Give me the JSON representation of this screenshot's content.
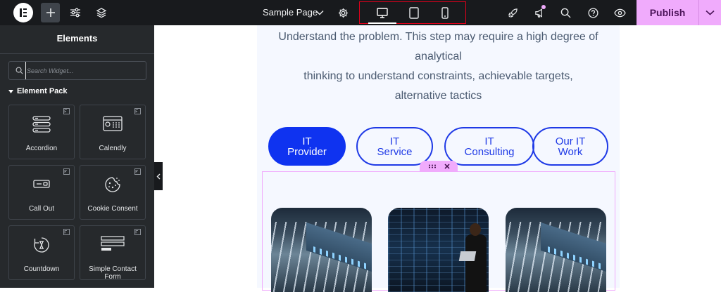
{
  "toolbar": {
    "page_name": "Sample Page",
    "publish_label": "Publish",
    "icons": [
      "elementor-logo-icon",
      "add-icon",
      "sliders-icon",
      "layers-icon",
      "chevron-down-icon",
      "gear-icon",
      "desktop-icon",
      "tablet-icon",
      "mobile-icon",
      "rocket-icon",
      "megaphone-icon",
      "search-icon",
      "help-icon",
      "eye-icon"
    ],
    "active_device": "desktop",
    "accent_color": "#f0abfc"
  },
  "sidebar": {
    "title": "Elements",
    "search_placeholder": "Search Widget...",
    "section_title": "Element Pack",
    "widgets": [
      {
        "label": "Accordion",
        "icon": "accordion-icon",
        "pro": true
      },
      {
        "label": "Calendly",
        "icon": "calendly-icon",
        "pro": true
      },
      {
        "label": "Call Out",
        "icon": "call-out-icon",
        "pro": true
      },
      {
        "label": "Cookie Consent",
        "icon": "cookie-icon",
        "pro": true
      },
      {
        "label": "Countdown",
        "icon": "countdown-icon",
        "pro": true
      },
      {
        "label": "Simple Contact Form",
        "icon": "contact-form-icon",
        "pro": true
      }
    ]
  },
  "canvas": {
    "intro_lines": [
      "Understand the problem. This step may require a high degree of",
      "analytical",
      "thinking to understand constraints, achievable targets,",
      "alternative tactics"
    ],
    "tabs": [
      {
        "line1": "IT",
        "line2": "Provider",
        "active": true
      },
      {
        "line1": "IT",
        "line2": "Service",
        "active": false
      },
      {
        "line1": "IT",
        "line2": "Consulting",
        "active": false
      },
      {
        "line1": "Our IT",
        "line2": "Work",
        "active": false
      }
    ],
    "tab_color": "#0f33f0"
  }
}
